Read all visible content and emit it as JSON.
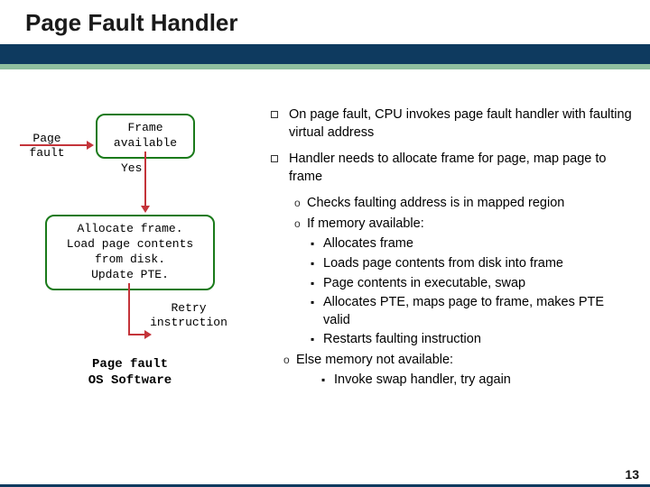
{
  "title": "Page Fault Handler",
  "pagenum": "13",
  "flow": {
    "pf_label": "Page\nfault",
    "frame_box": "Frame\navailable",
    "yes": "Yes",
    "alloc_box": "Allocate frame.\nLoad page contents\nfrom disk.\nUpdate PTE.",
    "retry": "Retry\ninstruction",
    "caption": "Page fault\nOS Software"
  },
  "bullets": {
    "b1": "On page fault, CPU invokes page fault handler with faulting virtual address",
    "b2": "Handler needs to allocate frame for page, map page to frame",
    "o1": "Checks faulting address is in mapped region",
    "o2": "If memory available:",
    "s1": "Allocates frame",
    "s2": "Loads page contents from disk into frame",
    "s3": "Page contents in executable, swap",
    "s4": "Allocates PTE, maps page to frame, makes PTE valid",
    "s5": "Restarts faulting instruction",
    "o3": "Else memory not available:",
    "s6": "Invoke swap handler, try again"
  }
}
